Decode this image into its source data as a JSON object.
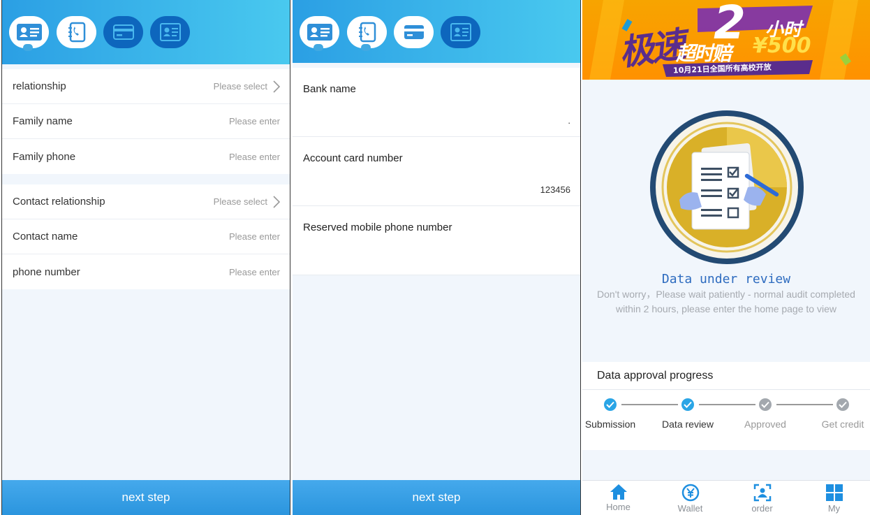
{
  "colors": {
    "accent": "#2b9fe4",
    "step_active": "#ffffff",
    "step_inactive": "#0d66bd",
    "review_title": "#2d6bbf"
  },
  "step_icons": [
    "id-card-icon",
    "phone-book-icon",
    "bank-card-icon",
    "certificate-icon"
  ],
  "contact_form": {
    "group1": [
      {
        "label": "relationship",
        "value": "Please select",
        "type": "select"
      },
      {
        "label": "Family name",
        "value": "Please enter",
        "type": "input"
      },
      {
        "label": "Family phone",
        "value": "Please enter",
        "type": "input"
      }
    ],
    "group2": [
      {
        "label": "Contact relationship",
        "value": "Please select",
        "type": "select"
      },
      {
        "label": "Contact name",
        "value": "Please enter",
        "type": "input"
      },
      {
        "label": "phone number",
        "value": "Please enter",
        "type": "input"
      }
    ],
    "next_label": "next step"
  },
  "bank_form": {
    "fields": [
      {
        "label": "Bank name",
        "value": "."
      },
      {
        "label": "Account card number",
        "value": "123456"
      },
      {
        "label": "Reserved mobile phone number",
        "value": ""
      }
    ],
    "next_label": "next step"
  },
  "review": {
    "banner": {
      "big_text": "极速",
      "sub_text": "超时赔",
      "num": "2",
      "unit": "小时",
      "money": "¥500",
      "note": "10月21日全国所有高校开放"
    },
    "title": "Data under review",
    "description": "Don't worry，Please wait patiently - normal audit completed within 2 hours, please enter the home page to view",
    "progress_title": "Data approval progress",
    "steps": [
      {
        "label": "Submission",
        "done": true
      },
      {
        "label": "Data review",
        "done": true
      },
      {
        "label": "Approved",
        "done": false
      },
      {
        "label": "Get credit",
        "done": false
      }
    ],
    "tabs": [
      {
        "label": "Home",
        "icon": "home-icon"
      },
      {
        "label": "Wallet",
        "icon": "wallet-icon"
      },
      {
        "label": "order",
        "icon": "order-icon"
      },
      {
        "label": "My",
        "icon": "grid-icon"
      }
    ]
  }
}
